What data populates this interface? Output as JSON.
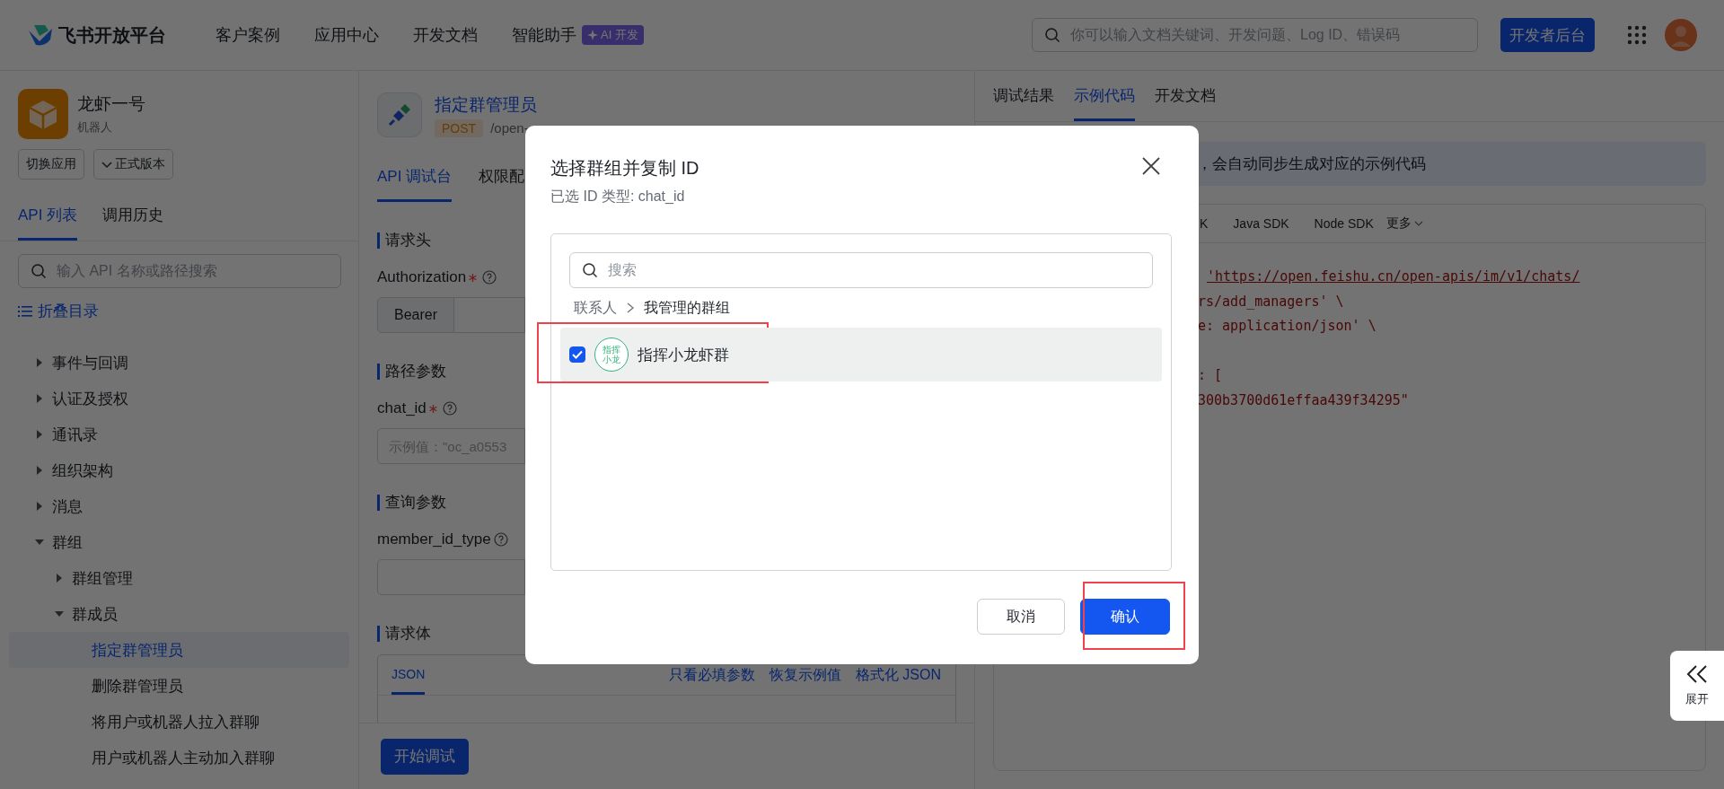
{
  "topbar": {
    "logo": "飞书开放平台",
    "nav": [
      {
        "label": "客户案例"
      },
      {
        "label": "应用中心"
      },
      {
        "label": "开发文档"
      },
      {
        "label": "智能助手",
        "badge": "AI 开发"
      }
    ],
    "search": {
      "placeholder": "你可以输入文档关键词、开发问题、Log ID、错误码"
    },
    "console_button": "开发者后台"
  },
  "sidebar": {
    "app": {
      "name": "龙虾一号",
      "type": "机器人"
    },
    "buttons": [
      {
        "label": "切换应用",
        "kind": "plain"
      },
      {
        "label": "正式版本",
        "kind": "dropdown"
      }
    ],
    "tabs": [
      {
        "label": "API 列表",
        "selected": true
      },
      {
        "label": "调用历史",
        "selected": false
      }
    ],
    "search": {
      "placeholder": "输入 API 名称或路径搜索"
    },
    "collapse_link": "折叠目录",
    "tree": [
      {
        "label": "事件与回调",
        "expanded": false,
        "selected": false
      },
      {
        "label": "认证及授权",
        "expanded": false,
        "selected": false
      },
      {
        "label": "通讯录",
        "expanded": false,
        "selected": false
      },
      {
        "label": "组织架构",
        "expanded": false,
        "selected": false
      },
      {
        "label": "消息",
        "expanded": false,
        "selected": false
      },
      {
        "label": "群组",
        "expanded": true,
        "selected": false,
        "children": [
          {
            "label": "群组管理",
            "expanded": false,
            "selected": false
          },
          {
            "label": "群成员",
            "expanded": true,
            "selected": false,
            "children": [
              {
                "label": "指定群管理员",
                "selected": true
              },
              {
                "label": "删除群管理员",
                "selected": false
              },
              {
                "label": "将用户或机器人拉入群聊",
                "selected": false
              },
              {
                "label": "用户或机器人主动加入群聊",
                "selected": false
              }
            ]
          }
        ]
      }
    ]
  },
  "api": {
    "title": "指定群管理员",
    "method": "POST",
    "path": "/open-",
    "tabs": [
      {
        "label": "API 调试台",
        "selected": true
      },
      {
        "label": "权限配",
        "selected": false
      }
    ],
    "sections": [
      {
        "title": "请求头",
        "params": [
          {
            "name": "Authorization",
            "required": true,
            "kind": "bearer",
            "prefix": "Bearer"
          }
        ]
      },
      {
        "title": "路径参数",
        "params": [
          {
            "name": "chat_id",
            "required": true,
            "kind": "text",
            "placeholder": "示例值：\"oc_a0553"
          }
        ]
      },
      {
        "title": "查询参数",
        "params": [
          {
            "name": "member_id_type",
            "required": false,
            "kind": "text"
          }
        ]
      }
    ],
    "body": {
      "title": "请求体",
      "tabs": [
        {
          "label": "JSON",
          "selected": true
        }
      ],
      "links": [
        "只看必填参数",
        "恢复示例值",
        "格式化 JSON"
      ]
    },
    "run_button": "开始调试"
  },
  "result": {
    "tabs": [
      {
        "label": "调试结果",
        "selected": false
      },
      {
        "label": "示例代码",
        "selected": true
      },
      {
        "label": "开发文档",
        "selected": false
      }
    ],
    "notice": "，会自动同步生成对应的示例代码",
    "sdk_tabs": [
      {
        "label": "K"
      },
      {
        "label": "Java SDK"
      },
      {
        "label": "Node SDK"
      }
    ],
    "more": "更多",
    "code_lines": [
      {
        "text": "'https://open.feishu.cn/open-apis/im/v1/chats/",
        "kind": "url"
      },
      {
        "text": "rs/add_managers' \\",
        "kind": "plain"
      },
      {
        "text": "e: application/json' \\",
        "kind": "plain"
      },
      {
        "text": ": [",
        "kind": "plain"
      },
      {
        "text": "300b3700d61effaa439f34295\"",
        "kind": "plain"
      }
    ]
  },
  "dialog": {
    "title": "选择群组并复制 ID",
    "subtitle": "已选 ID 类型: chat_id",
    "search": {
      "placeholder": "搜索"
    },
    "breadcrumb": [
      {
        "label": "联系人",
        "current": false
      },
      {
        "label": "我管理的群组",
        "current": true
      }
    ],
    "groups": [
      {
        "name": "指挥小龙虾群",
        "avatar": "指挥小龙",
        "checked": true,
        "highlighted": true
      }
    ],
    "buttons": [
      {
        "label": "取消",
        "kind": "secondary",
        "highlighted": false
      },
      {
        "label": "确认",
        "kind": "primary",
        "highlighted": true
      }
    ]
  },
  "expand_button": "展开"
}
